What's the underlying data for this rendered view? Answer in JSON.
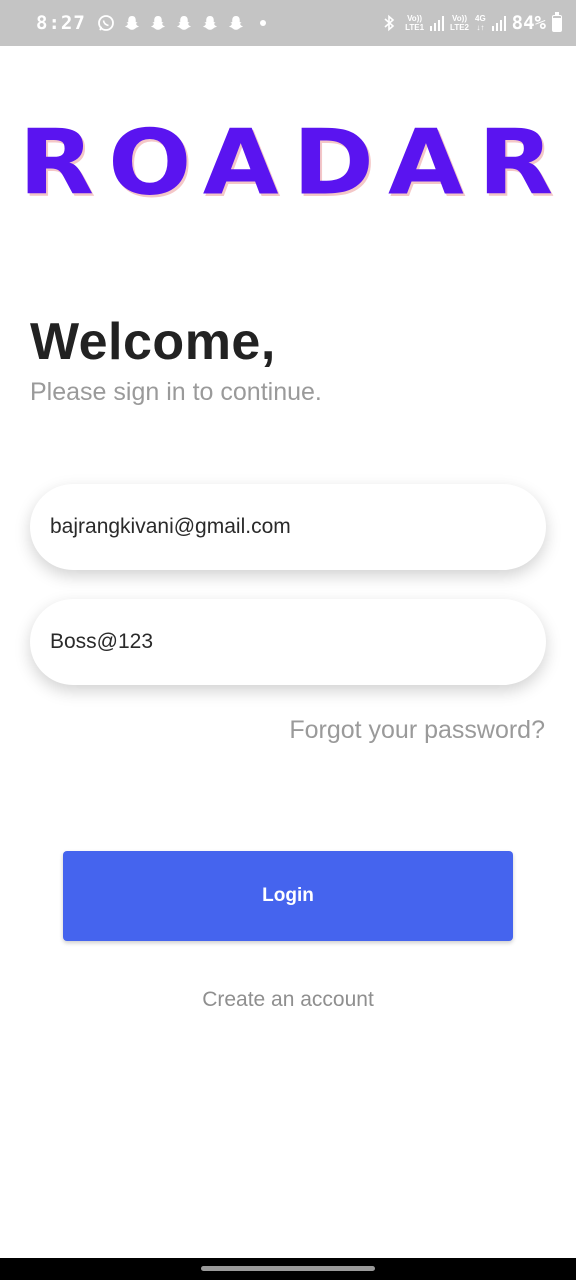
{
  "status_bar": {
    "time": "8:27",
    "icons": [
      "whatsapp-icon",
      "snapchat-icon",
      "snapchat-icon",
      "snapchat-icon",
      "snapchat-icon",
      "snapchat-icon"
    ],
    "sim1_top": "Vo))",
    "sim1_bottom": "LTE1",
    "sim2_top": "Vo))",
    "sim2_bottom": "LTE2",
    "network_type": "4G",
    "network_arrows": "↓↑",
    "battery_text": "84%",
    "battery_level": 0.84
  },
  "logo": {
    "text": "ROADAR",
    "color": "#5a14f0"
  },
  "welcome": {
    "title": "Welcome,",
    "subtitle": "Please sign in to continue."
  },
  "form": {
    "email_value": "bajrangkivani@gmail.com",
    "password_value": "Boss@123",
    "forgot_label": "Forgot your password?",
    "login_label": "Login",
    "create_account_label": "Create an account"
  },
  "colors": {
    "accent": "#4564ee",
    "status_bar_bg": "#c4c4c4",
    "muted_text": "#9a9a9a"
  }
}
